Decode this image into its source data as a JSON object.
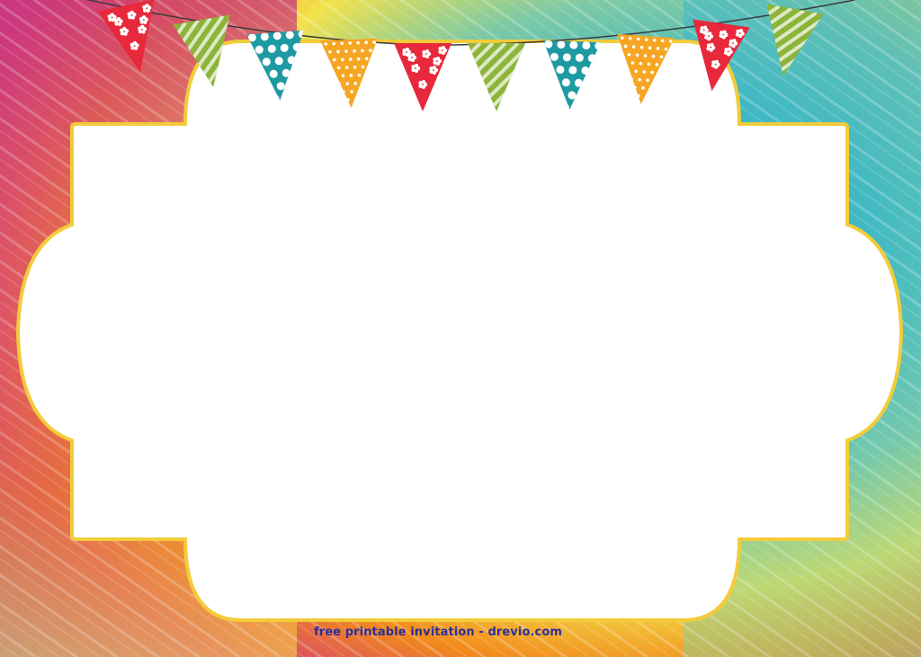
{
  "footer": {
    "credit": "free printable invitation - drevio.com"
  },
  "colors": {
    "background_palette": [
      "#d23a7c",
      "#8a4fb6",
      "#2fb4c6",
      "#7cc9a6",
      "#f3e24a",
      "#f28a1c",
      "#e63f36"
    ],
    "frame_fill": "#ffffff",
    "frame_border": "#f2cc3a",
    "credit_text": "#2b2f9e"
  },
  "bunting": {
    "flags": [
      {
        "color": "#e8283b",
        "pattern": "flowers"
      },
      {
        "color": "#8cb43a",
        "pattern": "stripes"
      },
      {
        "color": "#1e9aa3",
        "pattern": "dots"
      },
      {
        "color": "#f6a623",
        "pattern": "dots"
      },
      {
        "color": "#e8283b",
        "pattern": "flowers"
      },
      {
        "color": "#8cb43a",
        "pattern": "stripes"
      },
      {
        "color": "#1e9aa3",
        "pattern": "dots"
      },
      {
        "color": "#f6a623",
        "pattern": "dots"
      },
      {
        "color": "#e8283b",
        "pattern": "flowers"
      },
      {
        "color": "#8cb43a",
        "pattern": "stripes"
      }
    ]
  }
}
